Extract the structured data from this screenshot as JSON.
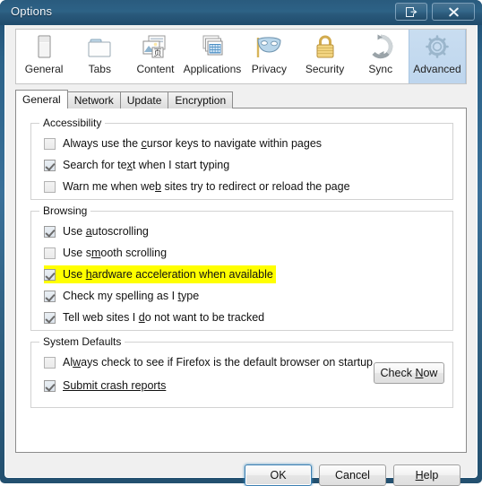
{
  "window": {
    "title": "Options",
    "buttons": [
      {
        "name": "help-button",
        "icon": "help-arrow-icon",
        "glyph": "⎙"
      },
      {
        "name": "close-button",
        "icon": "close-icon",
        "glyph": "✕"
      }
    ]
  },
  "toolbar": {
    "selected": "Advanced",
    "items": [
      {
        "label": "General",
        "icon": "general-window-icon"
      },
      {
        "label": "Tabs",
        "icon": "tabs-folder-icon"
      },
      {
        "label": "Content",
        "icon": "content-page-icon"
      },
      {
        "label": "Applications",
        "icon": "applications-windows-icon"
      },
      {
        "label": "Privacy",
        "icon": "privacy-mask-icon"
      },
      {
        "label": "Security",
        "icon": "security-padlock-icon"
      },
      {
        "label": "Sync",
        "icon": "sync-arrows-icon"
      },
      {
        "label": "Advanced",
        "icon": "advanced-gear-icon"
      }
    ]
  },
  "tabs": {
    "active": "General",
    "items": [
      {
        "label": "General"
      },
      {
        "label": "Network"
      },
      {
        "label": "Update"
      },
      {
        "label": "Encryption"
      }
    ]
  },
  "groups": {
    "accessibility": {
      "title": "Accessibility",
      "options": [
        {
          "pre": "Always use the ",
          "accel": "c",
          "post": "ursor keys to navigate within pages",
          "full": "Always use the cursor keys to navigate within pages",
          "checked": false,
          "highlighted": false
        },
        {
          "pre": "Search for te",
          "accel": "x",
          "post": "t when I start typing",
          "full": "Search for text when I start typing",
          "checked": true,
          "highlighted": false
        },
        {
          "pre": "Warn me when we",
          "accel": "b",
          "post": " sites try to redirect or reload the page",
          "full": "Warn me when web sites try to redirect or reload the page",
          "checked": false,
          "highlighted": false
        }
      ]
    },
    "browsing": {
      "title": "Browsing",
      "options": [
        {
          "pre": "Use ",
          "accel": "a",
          "post": "utoscrolling",
          "full": "Use autoscrolling",
          "checked": true,
          "highlighted": false
        },
        {
          "pre": "Use s",
          "accel": "m",
          "post": "ooth scrolling",
          "full": "Use smooth scrolling",
          "checked": false,
          "highlighted": false
        },
        {
          "pre": "Use ",
          "accel": "h",
          "post": "ardware acceleration when available",
          "full": "Use hardware acceleration when available",
          "checked": true,
          "highlighted": true
        },
        {
          "pre": "Check my spelling as I ",
          "accel": "t",
          "post": "ype",
          "full": "Check my spelling as I type",
          "checked": true,
          "highlighted": false
        },
        {
          "pre": "Tell web sites I ",
          "accel": "d",
          "post": "o not want to be tracked",
          "full": "Tell web sites I do not want to be tracked",
          "checked": true,
          "highlighted": false
        }
      ]
    },
    "system_defaults": {
      "title": "System Defaults",
      "options": [
        {
          "pre": "Al",
          "accel": "w",
          "post": "ays check to see if Firefox is the default browser on startup",
          "full": "Always check to see if Firefox is the default browser on startup",
          "checked": false,
          "highlighted": false
        },
        {
          "pre": "Submit crash reports",
          "accel": "",
          "post": "",
          "full": "Submit crash reports",
          "checked": true,
          "highlighted": false
        }
      ],
      "check_now": {
        "pre": "Check ",
        "accel": "N",
        "post": "ow",
        "full": "Check Now"
      }
    }
  },
  "footer": {
    "buttons": [
      {
        "pre": "OK",
        "accel": "",
        "post": "",
        "full": "OK",
        "name": "ok-button",
        "default": true
      },
      {
        "pre": "Cancel",
        "accel": "",
        "post": "",
        "full": "Cancel",
        "name": "cancel-button",
        "default": false
      },
      {
        "pre": "",
        "accel": "H",
        "post": "elp",
        "full": "Help",
        "name": "help-button",
        "default": false
      }
    ]
  },
  "colors": {
    "titlebar": "#2d6286",
    "selected_tool": "#c2d9ef",
    "highlight": "#ffff00",
    "panel": "#ffffff",
    "client": "#f0f0f0"
  }
}
